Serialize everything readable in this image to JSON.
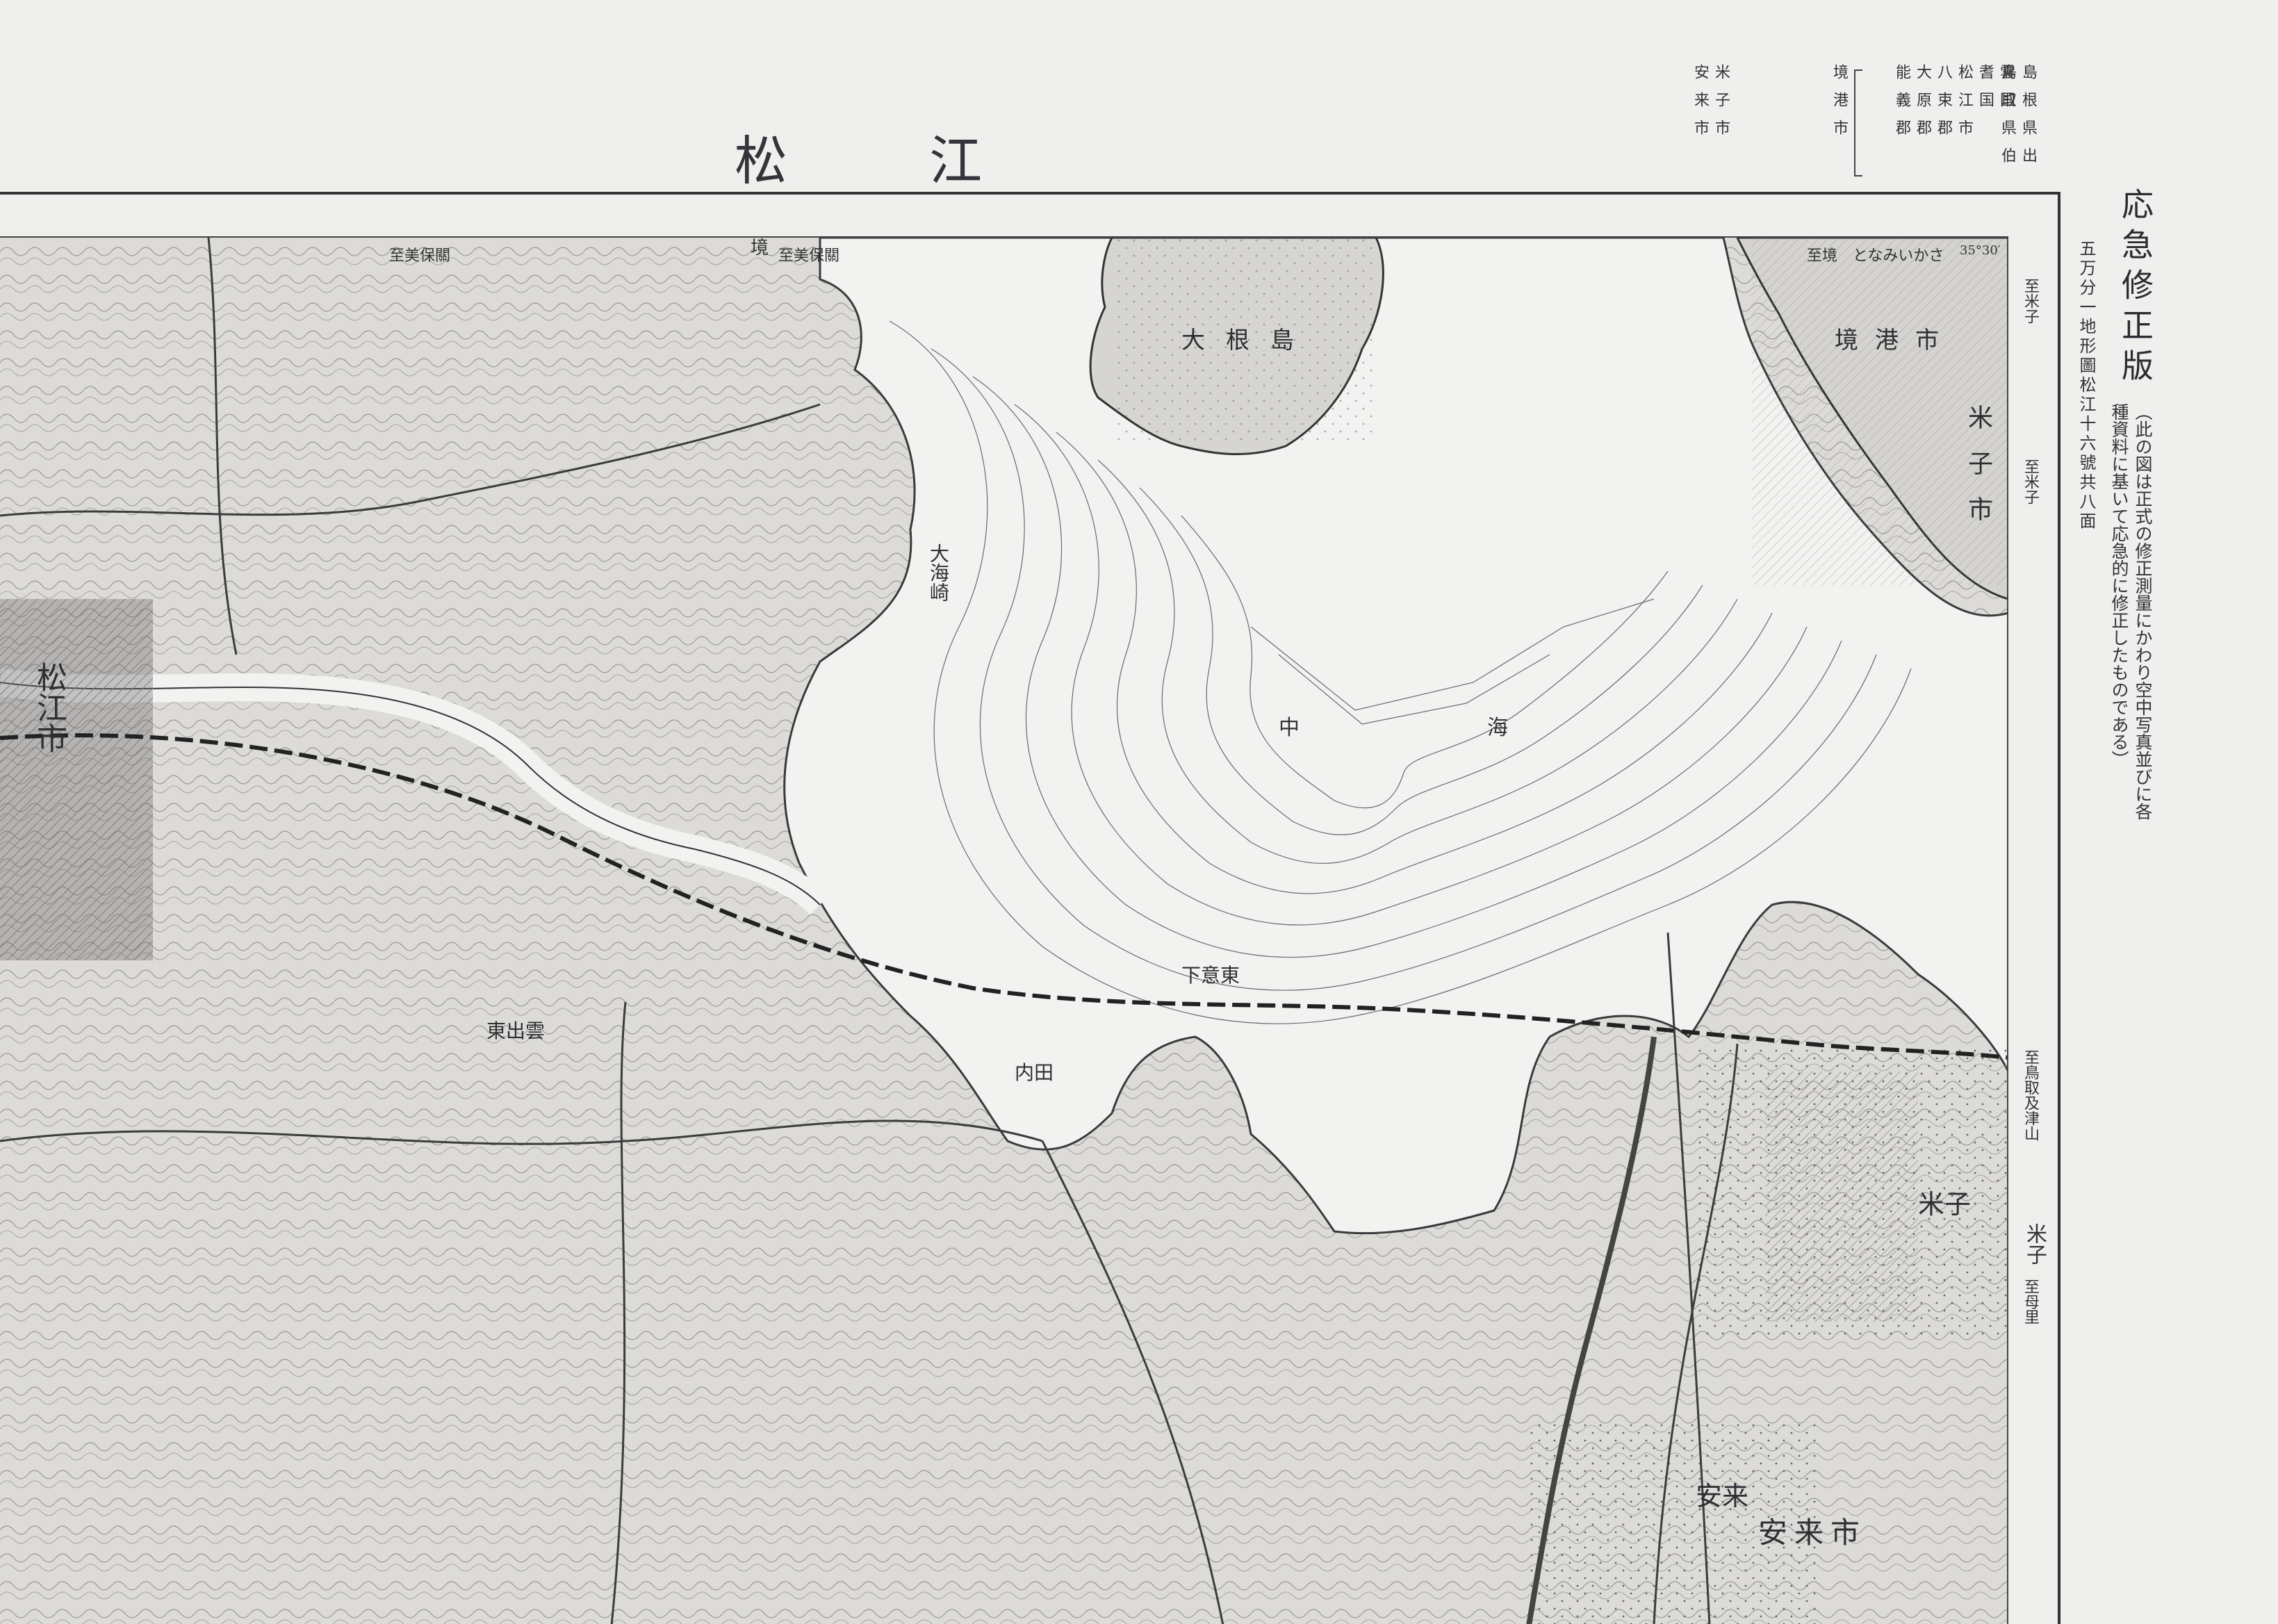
{
  "sheet": {
    "title": "松 江",
    "revision_title": "応急修正版",
    "sheet_id": "五万分一地形圖松江十六號共八面",
    "revision_note": "（此の図は正式の修正測量にかわり空中写真並びに各種資料に基いて応急的に修正したものである）"
  },
  "admin": {
    "columns": [
      "島根県出雲国",
      "松江市",
      "八束郡",
      "大原郡",
      "能義郡",
      "安来市",
      "鳥取県伯耆国",
      "境港市",
      "米子市"
    ]
  },
  "edges": {
    "top_left": "至美保關",
    "top_mid_a": "境",
    "top_mid_b": "至美保關",
    "top_right": "至境　となみいかさ",
    "right_1": "至米子",
    "right_2": "至米子",
    "right_3": "至鳥取及津山",
    "right_4": "米子",
    "right_5": "至母里",
    "coord_tr": "35°30′"
  },
  "places": {
    "matsue_city": "松江市",
    "sakaiminato_city": "境港市",
    "yonago_city": "米子市",
    "yasugi_city": "安来市",
    "nakaumi": "中　海",
    "daikon_jima": "大根島",
    "ohazaki": "大海崎",
    "yonago_label": "米子",
    "yasugi_label": "安来",
    "higashi_izumo": "東出雲",
    "shimo_iu": "下意東",
    "uchinada": "内田"
  },
  "colors": {
    "paper": "#efefee",
    "ink": "#2b2a2e",
    "water": "#f1f1f0",
    "land": "#d9d8d5"
  }
}
